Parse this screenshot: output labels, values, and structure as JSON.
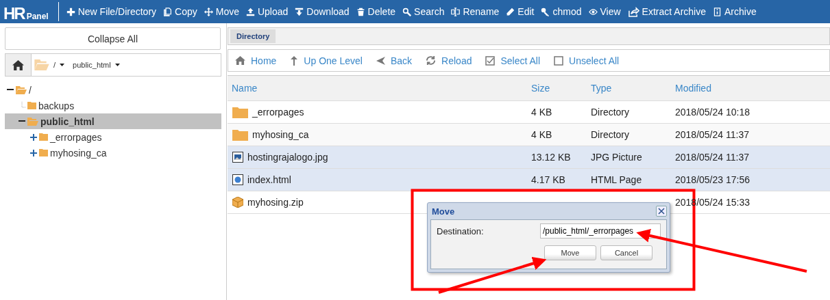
{
  "logo": {
    "big": "HR",
    "small": "Panel"
  },
  "toolbar": [
    {
      "kind": "plus",
      "label": "New File/Directory"
    },
    {
      "kind": "copy",
      "label": "Copy"
    },
    {
      "kind": "move",
      "label": "Move"
    },
    {
      "kind": "upload",
      "label": "Upload"
    },
    {
      "kind": "download",
      "label": "Download"
    },
    {
      "kind": "trash",
      "label": "Delete"
    },
    {
      "kind": "search",
      "label": "Search"
    },
    {
      "kind": "rename",
      "label": "Rename"
    },
    {
      "kind": "pencil",
      "label": "Edit"
    },
    {
      "kind": "key",
      "label": "chmod"
    },
    {
      "kind": "eye",
      "label": "View"
    },
    {
      "kind": "share",
      "label": "Extract Archive"
    },
    {
      "kind": "archive",
      "label": "Archive"
    }
  ],
  "sidebar": {
    "collapse_button": "Collapse All",
    "breadcrumb": [
      "/",
      "public_html"
    ],
    "tree": [
      {
        "label": "/",
        "expandable": true,
        "expanded": true,
        "selected": false,
        "children": [
          {
            "label": "backups",
            "expandable": false,
            "expanded": false,
            "selected": false
          },
          {
            "label": "public_html",
            "expandable": true,
            "expanded": true,
            "selected": true,
            "children": [
              {
                "label": "_errorpages",
                "expandable": true,
                "expanded": false,
                "selected": false
              },
              {
                "label": "myhosing_ca",
                "expandable": true,
                "expanded": false,
                "selected": false
              }
            ]
          }
        ]
      }
    ]
  },
  "tab": {
    "label": "Directory"
  },
  "nav": [
    {
      "kind": "home",
      "label": "Home"
    },
    {
      "kind": "up",
      "label": "Up One Level"
    },
    {
      "kind": "back",
      "label": "Back"
    },
    {
      "kind": "reload",
      "label": "Reload"
    },
    {
      "kind": "checked",
      "label": "Select All"
    },
    {
      "kind": "unchecked",
      "label": "Unselect All"
    }
  ],
  "table": {
    "columns": [
      "Name",
      "Size",
      "Type",
      "Modified"
    ],
    "rows": [
      {
        "kind": "folder",
        "name": "_errorpages",
        "size": "4 KB",
        "type": "Directory",
        "modified": "2018/05/24 10:18",
        "selected": false
      },
      {
        "kind": "folder",
        "name": "myhosing_ca",
        "size": "4 KB",
        "type": "Directory",
        "modified": "2018/05/24 11:37",
        "selected": false
      },
      {
        "kind": "image",
        "name": "hostingrajalogo.jpg",
        "size": "13.12 KB",
        "type": "JPG Picture",
        "modified": "2018/05/24 11:37",
        "selected": true
      },
      {
        "kind": "html",
        "name": "index.html",
        "size": "4.17 KB",
        "type": "HTML Page",
        "modified": "2018/05/23 17:56",
        "selected": true
      },
      {
        "kind": "zip",
        "name": "myhosing.zip",
        "modified": "2018/05/24 15:33",
        "selected": false
      }
    ]
  },
  "dialog": {
    "title": "Move",
    "field_label": "Destination:",
    "value": "/public_html/_errorpages",
    "buttons": [
      "Move",
      "Cancel"
    ]
  }
}
